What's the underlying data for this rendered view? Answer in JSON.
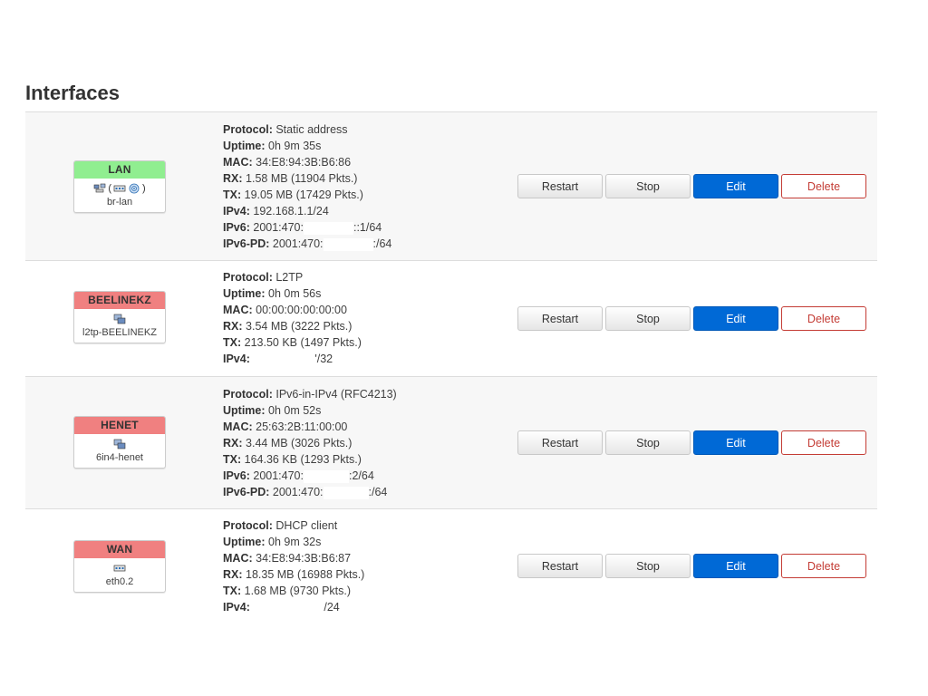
{
  "page": {
    "title": "Interfaces"
  },
  "colors": {
    "up_badge": "#90ee90",
    "down_badge": "#f08080",
    "edit_button": "#0069d6",
    "delete_text": "#c43c35"
  },
  "buttons": {
    "restart": "Restart",
    "stop": "Stop",
    "edit": "Edit",
    "delete": "Delete"
  },
  "labels": {
    "protocol": "Protocol:",
    "uptime": "Uptime:",
    "mac": "MAC:",
    "rx": "RX:",
    "tx": "TX:",
    "ipv4": "IPv4:",
    "ipv6": "IPv6:",
    "ipv6pd": "IPv6-PD:"
  },
  "interfaces": [
    {
      "name": "LAN",
      "status_color": "green",
      "device": "br-lan",
      "icons": [
        "bridge-icon",
        "ethernet-switch-icon",
        "wifi-icon"
      ],
      "protocol": "Static address",
      "uptime": "0h 9m 35s",
      "mac": "34:E8:94:3B:B6:86",
      "rx": "1.58 MB (11904 Pkts.)",
      "tx": "19.05 MB (17429 Pkts.)",
      "ipv4": "192.168.1.1/24",
      "ipv6_prefix": "2001:470:",
      "ipv6_suffix": "::1/64",
      "ipv6pd_prefix": "2001:470:",
      "ipv6pd_suffix": ":/64"
    },
    {
      "name": "BEELINEKZ",
      "status_color": "red",
      "device": "l2tp-BEELINEKZ",
      "icons": [
        "tunnel-icon"
      ],
      "protocol": "L2TP",
      "uptime": "0h 0m 56s",
      "mac": "00:00:00:00:00:00",
      "rx": "3.54 MB (3222 Pkts.)",
      "tx": "213.50 KB (1497 Pkts.)",
      "ipv4_suffix": "'/32"
    },
    {
      "name": "HENET",
      "status_color": "red",
      "device": "6in4-henet",
      "icons": [
        "tunnel-icon"
      ],
      "protocol": "IPv6-in-IPv4 (RFC4213)",
      "uptime": "0h 0m 52s",
      "mac": "25:63:2B:11:00:00",
      "rx": "3.44 MB (3026 Pkts.)",
      "tx": "164.36 KB (1293 Pkts.)",
      "ipv6_prefix": "2001:470:",
      "ipv6_suffix": ":2/64",
      "ipv6pd_prefix": "2001:470:",
      "ipv6pd_suffix": ":/64"
    },
    {
      "name": "WAN",
      "status_color": "red",
      "device": "eth0.2",
      "icons": [
        "ethernet-icon"
      ],
      "protocol": "DHCP client",
      "uptime": "0h 9m 32s",
      "mac": "34:E8:94:3B:B6:87",
      "rx": "18.35 MB (16988 Pkts.)",
      "tx": "1.68 MB (9730 Pkts.)",
      "ipv4_suffix": "/24"
    }
  ]
}
